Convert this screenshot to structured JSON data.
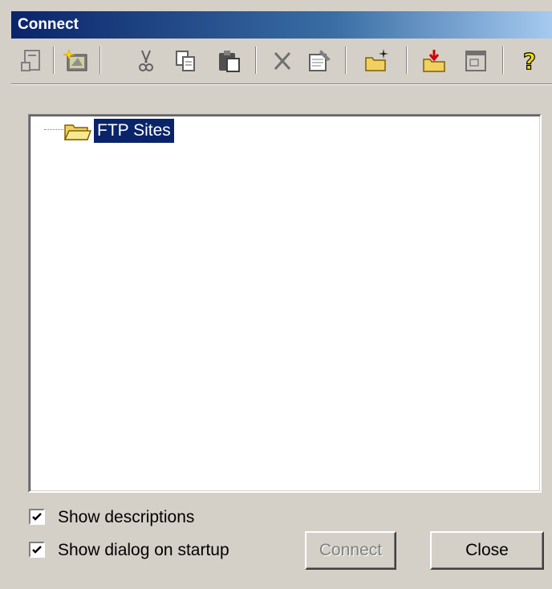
{
  "window": {
    "title": "Connect"
  },
  "toolbar": {
    "buttons": [
      {
        "icon": "connect-icon"
      },
      {
        "icon": "new-site-icon"
      },
      {
        "icon": "cut-icon"
      },
      {
        "icon": "copy-icon"
      },
      {
        "icon": "paste-icon"
      },
      {
        "icon": "delete-icon"
      },
      {
        "icon": "properties-icon"
      },
      {
        "icon": "new-folder-icon"
      },
      {
        "icon": "import-icon"
      },
      {
        "icon": "window-icon"
      },
      {
        "icon": "help-icon"
      }
    ]
  },
  "tree": {
    "root_label": "FTP Sites"
  },
  "options": {
    "show_descriptions": {
      "label": "Show descriptions",
      "checked": true
    },
    "show_dialog_on_startup": {
      "label": "Show dialog on startup",
      "checked": true
    }
  },
  "buttons": {
    "connect": "Connect",
    "close": "Close"
  },
  "colors": {
    "title_start": "#0a246a",
    "title_end": "#a6caf0",
    "selection": "#0a246a",
    "face": "#d4d0c8"
  }
}
